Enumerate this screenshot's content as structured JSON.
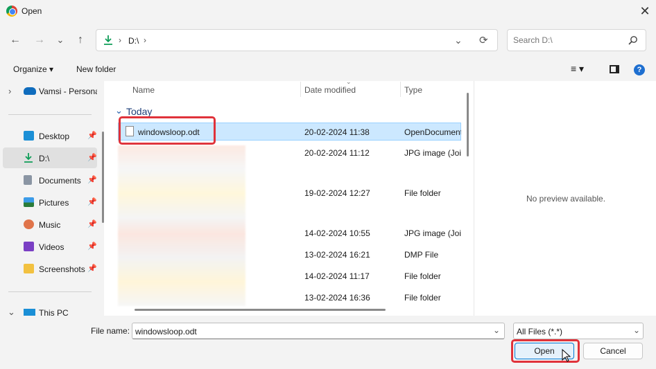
{
  "window": {
    "title": "Open",
    "close_glyph": "✕"
  },
  "nav": {
    "back": "←",
    "forward": "→",
    "recent": "⌄",
    "up": "↑"
  },
  "address": {
    "icon": "download-icon",
    "chev1": "›",
    "path": "D:\\",
    "chev2": "›",
    "dropdown": "⌄",
    "refresh": "⟳"
  },
  "search": {
    "placeholder": "Search D:\\",
    "icon": "🔍"
  },
  "toolbar": {
    "organize": "Organize ▾",
    "new_folder": "New folder",
    "view_icon": "≡ ▾",
    "pane_icon": "▯",
    "help": "?"
  },
  "sidebar": {
    "top": {
      "chevron": "›",
      "label": "Vamsi - Persona"
    },
    "items": [
      {
        "label": "Desktop",
        "icon": "desktop-icon",
        "pinned": "📌"
      },
      {
        "label": "D:\\",
        "icon": "download-icon",
        "pinned": "📌"
      },
      {
        "label": "Documents",
        "icon": "documents-icon",
        "pinned": "📌"
      },
      {
        "label": "Pictures",
        "icon": "pictures-icon",
        "pinned": "📌"
      },
      {
        "label": "Music",
        "icon": "music-icon",
        "pinned": "📌"
      },
      {
        "label": "Videos",
        "icon": "videos-icon",
        "pinned": "📌"
      },
      {
        "label": "Screenshots",
        "icon": "folder-icon",
        "pinned": "📌"
      }
    ],
    "this_pc": {
      "chevron": "⌄",
      "label": "This PC"
    }
  },
  "columns": {
    "name": "Name",
    "date": "Date modified",
    "type": "Type"
  },
  "group": {
    "chevron": "⌄",
    "label": "Today"
  },
  "files": [
    {
      "name": "windowsloop.odt",
      "date": "20-02-2024 11:38",
      "type": "OpenDocument"
    },
    {
      "name": "",
      "date": "20-02-2024 11:12",
      "type": "JPG image (Join"
    },
    {
      "name": "",
      "date": "19-02-2024 12:27",
      "type": "File folder"
    },
    {
      "name": "",
      "date": "14-02-2024 10:55",
      "type": "JPG image (Join"
    },
    {
      "name": "",
      "date": "13-02-2024 16:21",
      "type": "DMP File"
    },
    {
      "name": "",
      "date": "14-02-2024 11:17",
      "type": "File folder"
    },
    {
      "name": "",
      "date": "13-02-2024 16:36",
      "type": "File folder"
    }
  ],
  "preview": {
    "text": "No preview available."
  },
  "footer": {
    "filename_label": "File name:",
    "filename_value": "windowsloop.odt",
    "filetype_value": "All Files (*.*)",
    "open_label": "Open",
    "cancel_label": "Cancel",
    "dropdown": "⌄"
  },
  "colors": {
    "accent": "#0078d4",
    "highlight": "#e0323a",
    "selection": "#cce8ff"
  }
}
